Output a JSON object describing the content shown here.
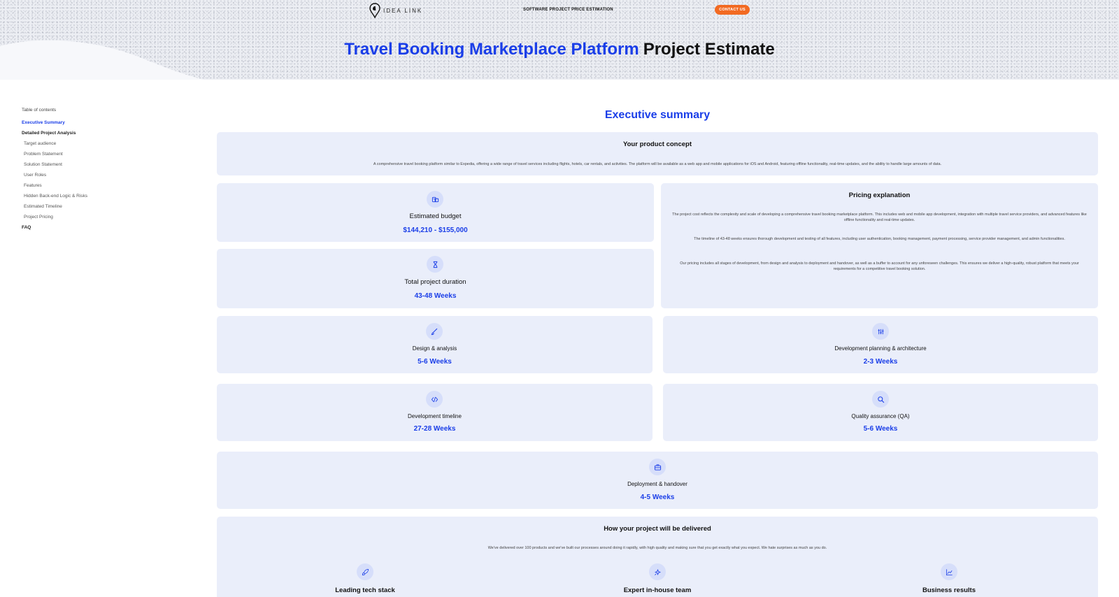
{
  "header": {
    "logo_text": "IDEA LINK",
    "nav_center": "SOFTWARE PROJECT PRICE ESTIMATION",
    "contact_label": "CONTACT US",
    "title_accent": "Travel Booking Marketplace Platform",
    "title_rest": "Project Estimate"
  },
  "toc": {
    "heading": "Table of contents",
    "items": [
      {
        "label": "Executive Summary"
      },
      {
        "label": "Detailed Project Analysis"
      },
      {
        "label": "Target audience"
      },
      {
        "label": "Problem Statement"
      },
      {
        "label": "Solution Statement"
      },
      {
        "label": "User Roles"
      },
      {
        "label": "Features"
      },
      {
        "label": "Hidden Back-end Logic & Risks"
      },
      {
        "label": "Estimated Timeline"
      },
      {
        "label": "Project Pricing"
      },
      {
        "label": "FAQ"
      }
    ]
  },
  "main": {
    "section_title": "Executive summary",
    "concept": {
      "title": "Your product concept",
      "body": "A comprehensive travel booking platform similar to Expedia, offering a wide range of travel services including flights, hotels, car rentals, and activities. The platform will be available as a web app and mobile applications for iOS and Android, featuring offline functionality, real-time updates, and the ability to handle large amounts of data."
    },
    "budget": {
      "label": "Estimated budget",
      "value": "$144,210 - $155,000",
      "icon": "money-icon"
    },
    "duration": {
      "label": "Total project duration",
      "value": "43-48 Weeks",
      "icon": "hourglass-icon"
    },
    "pricing": {
      "title": "Pricing explanation",
      "p1": "The project cost reflects the complexity and scale of developing a comprehensive travel booking marketplace platform. This includes web and mobile app development, integration with multiple travel service providers, and advanced features like offline functionality and real-time updates.",
      "p2": "The timeline of 43-48 weeks ensures thorough development and testing of all features, including user authentication, booking management, payment processing, service provider management, and admin functionalities.",
      "p3": "Our pricing includes all stages of development, from design and analysis to deployment and handover, as well as a buffer to account for any unforeseen challenges. This ensures we deliver a high-quality, robust platform that meets your requirements for a competitive travel booking solution."
    },
    "phases": [
      {
        "label": "Design & analysis",
        "value": "5-6 Weeks",
        "icon": "brush-icon"
      },
      {
        "label": "Development planning & architecture",
        "value": "2-3 Weeks",
        "icon": "sliders-icon"
      },
      {
        "label": "Development timeline",
        "value": "27-28 Weeks",
        "icon": "code-icon"
      },
      {
        "label": "Quality assurance (QA)",
        "value": "5-6 Weeks",
        "icon": "magnifier-icon"
      },
      {
        "label": "Deployment & handover",
        "value": "4-5 Weeks",
        "icon": "briefcase-icon"
      }
    ],
    "delivery": {
      "title": "How your project will be delivered",
      "body": "We've delivered over 100 products and we've built our processes around doing it rapidly, with high quality and making sure that you get exactly what you expect. We hate surprises as much as you do.",
      "items": [
        {
          "label": "Leading tech stack",
          "icon": "rocket-icon"
        },
        {
          "label": "Expert in-house team",
          "icon": "sparkle-icon"
        },
        {
          "label": "Business results",
          "icon": "chart-icon"
        }
      ]
    }
  },
  "colors": {
    "accent": "#1a3ee8",
    "contact": "#f26a22",
    "card": "#eaeefa",
    "icon_bg": "#d6defa"
  }
}
